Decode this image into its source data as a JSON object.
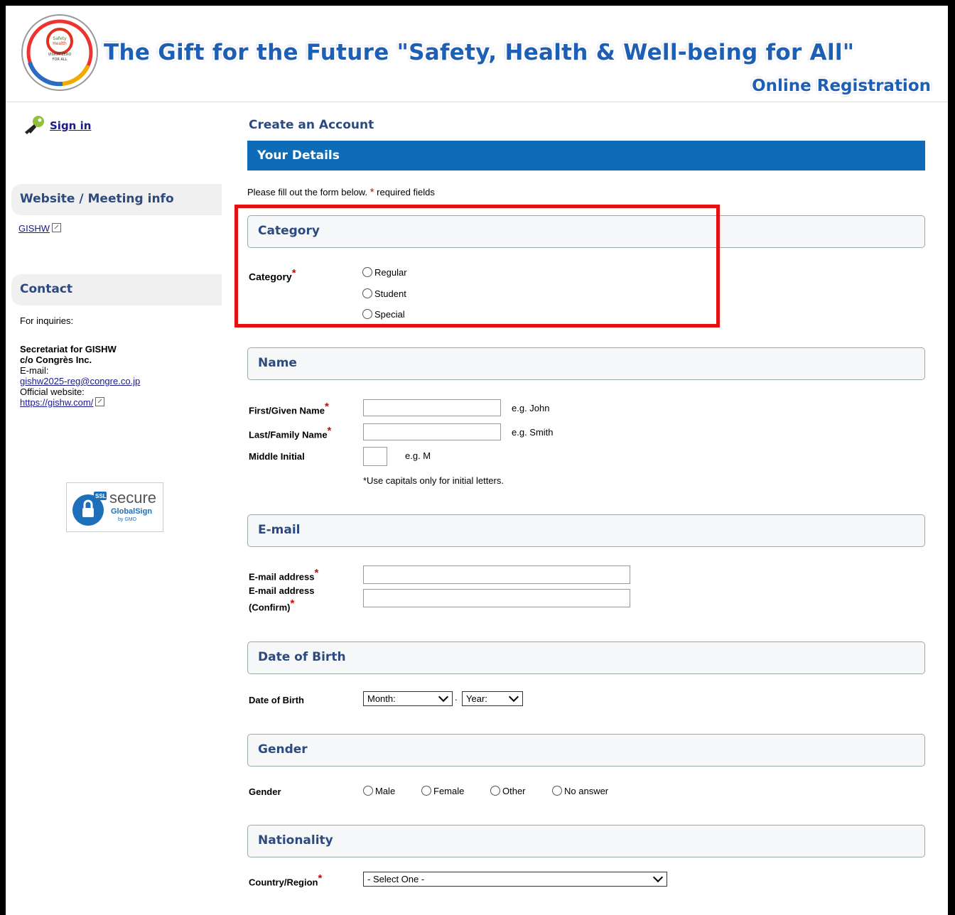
{
  "header": {
    "logo_text": "Safety Health Well-being",
    "title": "The Gift for the Future \"Safety, Health & Well-being for All\"",
    "subtitle": "Online Registration"
  },
  "sidebar": {
    "sign_in": "Sign in",
    "website_heading": "Website / Meeting info",
    "website_link": "GISHW",
    "contact_heading": "Contact",
    "inquiries": "For inquiries:",
    "secretariat_line1": "Secretariat for GISHW",
    "secretariat_line2": "c/o Congrès Inc.",
    "email_label": "E-mail:",
    "email": "gishw2025-reg@congre.co.jp",
    "website_label": "Official website:",
    "website_url": "https://gishw.com/",
    "ssl_badge": {
      "tag": "SSL",
      "word": "secure",
      "brand": "GlobalSign",
      "by": "by GMO"
    }
  },
  "main": {
    "page_title": "Create an Account",
    "details_bar": "Your Details",
    "intro_before": "Please fill out the form below.",
    "intro_star": "*",
    "intro_after": " required fields",
    "category": {
      "heading": "Category",
      "label": "Category",
      "options": [
        "Regular",
        "Student",
        "Special"
      ]
    },
    "name": {
      "heading": "Name",
      "first_label": "First/Given Name",
      "first_hint": "e.g. John",
      "last_label": "Last/Family Name",
      "last_hint": "e.g. Smith",
      "middle_label": "Middle Initial",
      "middle_hint": "e.g. M",
      "note": "*Use capitals only for initial letters."
    },
    "email": {
      "heading": "E-mail",
      "address_label": "E-mail address",
      "confirm_label_1": "E-mail address",
      "confirm_label_2": "(Confirm)"
    },
    "dob": {
      "heading": "Date of Birth",
      "label": "Date of Birth",
      "month": "Month:",
      "separator": ".",
      "year": "Year:"
    },
    "gender": {
      "heading": "Gender",
      "label": "Gender",
      "options": [
        "Male",
        "Female",
        "Other",
        "No answer"
      ]
    },
    "nationality": {
      "heading": "Nationality",
      "label": "Country/Region",
      "selected": "- Select One -"
    },
    "required_star": "*"
  },
  "colors": {
    "brand_blue": "#0d6bb8",
    "heading_navy": "#2c4a80",
    "required_red": "#e00000",
    "highlight_red": "#e61010"
  }
}
